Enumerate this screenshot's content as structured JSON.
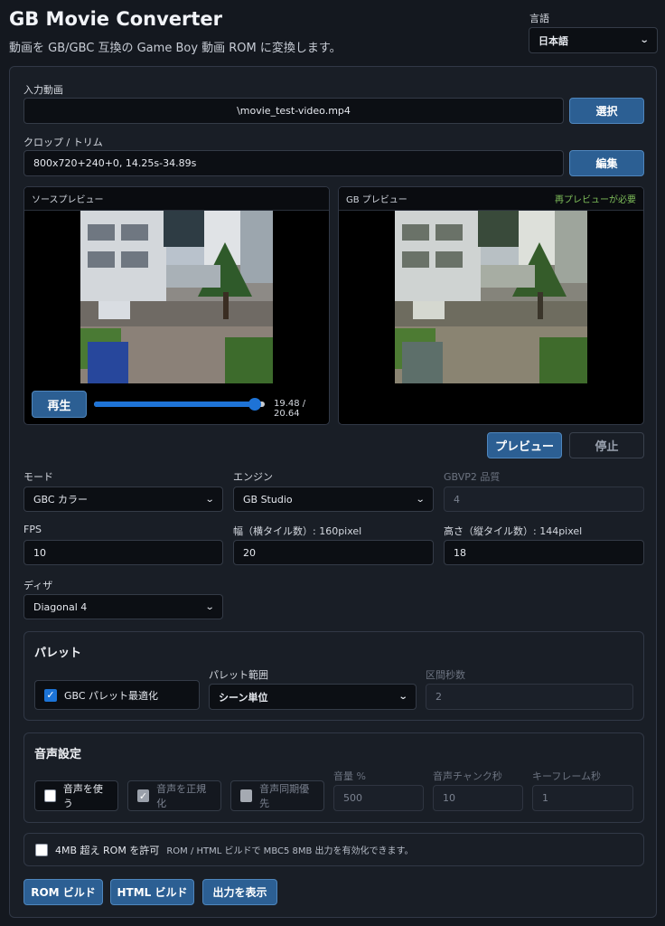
{
  "header": {
    "title": "GB Movie Converter",
    "subtitle": "動画を GB/GBC 互換の Game Boy 動画 ROM に変換します。",
    "language_label": "言語",
    "language_value": "日本語"
  },
  "input": {
    "label": "入力動画",
    "value": "\\movie_test-video.mp4",
    "select_button": "選択"
  },
  "crop": {
    "label": "クロップ / トリム",
    "value": "800x720+240+0, 14.25s-34.89s",
    "edit_button": "編集"
  },
  "source_preview": {
    "title": "ソースプレビュー",
    "play_button": "再生",
    "time": "19.48 / 20.64",
    "progress": 0.944
  },
  "gb_preview": {
    "title": "GB プレビュー",
    "status": "再プレビューが必要"
  },
  "preview_actions": {
    "preview_button": "プレビュー",
    "stop_button": "停止"
  },
  "settings": {
    "mode_label": "モード",
    "mode_value": "GBC カラー",
    "engine_label": "エンジン",
    "engine_value": "GB Studio",
    "quality_label": "GBVP2 品質",
    "quality_value": "4",
    "fps_label": "FPS",
    "fps_value": "10",
    "width_label": "幅（横タイル数）: 160pixel",
    "width_value": "20",
    "height_label": "高さ（縦タイル数）: 144pixel",
    "height_value": "18",
    "dither_label": "ディザ",
    "dither_value": "Diagonal 4"
  },
  "palette": {
    "title": "パレット",
    "optimize_label": "GBC パレット最適化",
    "optimize_checked": true,
    "range_label": "パレット範囲",
    "range_value": "シーン単位",
    "interval_label": "区間秒数",
    "interval_value": "2"
  },
  "audio": {
    "title": "音声設定",
    "use_audio_label": "音声を使う",
    "normalize_label": "音声を正規化",
    "sync_label": "音声同期優先",
    "volume_label": "音量 %",
    "volume_value": "500",
    "chunk_label": "音声チャンク秒",
    "chunk_value": "10",
    "keyframe_label": "キーフレーム秒",
    "keyframe_value": "1"
  },
  "rom4mb": {
    "label": "4MB 超え ROM を許可",
    "description": "ROM / HTML ビルドで MBC5 8MB 出力を有効化できます。"
  },
  "actions": {
    "rom_build": "ROM ビルド",
    "html_build": "HTML ビルド",
    "show_output": "出力を表示"
  },
  "colors": {
    "background": "#14181f",
    "panel": "#191e26",
    "accent": "#2c5f93",
    "status_green": "#7fbf5a"
  }
}
